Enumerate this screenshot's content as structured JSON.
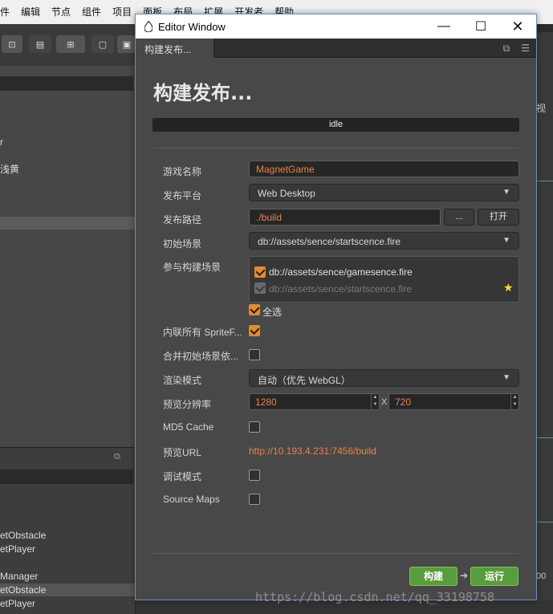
{
  "background": {
    "menu_items": [
      "件",
      "编辑",
      "节点",
      "组件",
      "项目",
      "面板",
      "布局",
      "扩展",
      "开发者",
      "帮助"
    ],
    "left_items": [
      "r",
      "浅黄"
    ],
    "lower_items": [
      "etObstacle",
      "etPlayer",
      "Manager",
      "etObstacle",
      "etPlayer"
    ],
    "right_labels": [
      "视",
      "00"
    ],
    "watermark": "https://blog.csdn.net/qq_33198758"
  },
  "window": {
    "title": "Editor Window",
    "tab_label": "构建发布...",
    "heading": "构建发布...",
    "status": "idle"
  },
  "form": {
    "game_name": {
      "label": "游戏名称",
      "value": "MagnetGame"
    },
    "platform": {
      "label": "发布平台",
      "value": "Web Desktop"
    },
    "build_path": {
      "label": "发布路径",
      "value": "./build",
      "browse": "...",
      "open": "打开"
    },
    "start_scene": {
      "label": "初始场景",
      "value": "db://assets/sence/startscence.fire"
    },
    "scenes": {
      "label": "参与构建场景",
      "items": [
        {
          "path": "db://assets/sence/gamesence.fire",
          "checked": true
        },
        {
          "path": "db://assets/sence/startscence.fire",
          "checked": true
        }
      ],
      "select_all": "全选"
    },
    "inline_sprite": {
      "label": "内联所有 SpriteF...",
      "checked": true
    },
    "merge_start": {
      "label": "合并初始场景依...",
      "checked": false
    },
    "render_mode": {
      "label": "渲染模式",
      "value": "自动（优先 WebGL）"
    },
    "resolution": {
      "label": "预览分辨率",
      "width": "1280",
      "separator": "X",
      "height": "720"
    },
    "md5": {
      "label": "MD5 Cache",
      "checked": false
    },
    "preview_url": {
      "label": "预览URL",
      "value": "http://10.193.4.231:7456/build"
    },
    "debug": {
      "label": "调试模式",
      "checked": false
    },
    "source_maps": {
      "label": "Source Maps",
      "checked": false
    }
  },
  "actions": {
    "build": "构建",
    "run": "运行"
  },
  "colors": {
    "accent": "#e48b2f",
    "value_text": "#e8824a",
    "button_green": "#5a9b3e"
  }
}
